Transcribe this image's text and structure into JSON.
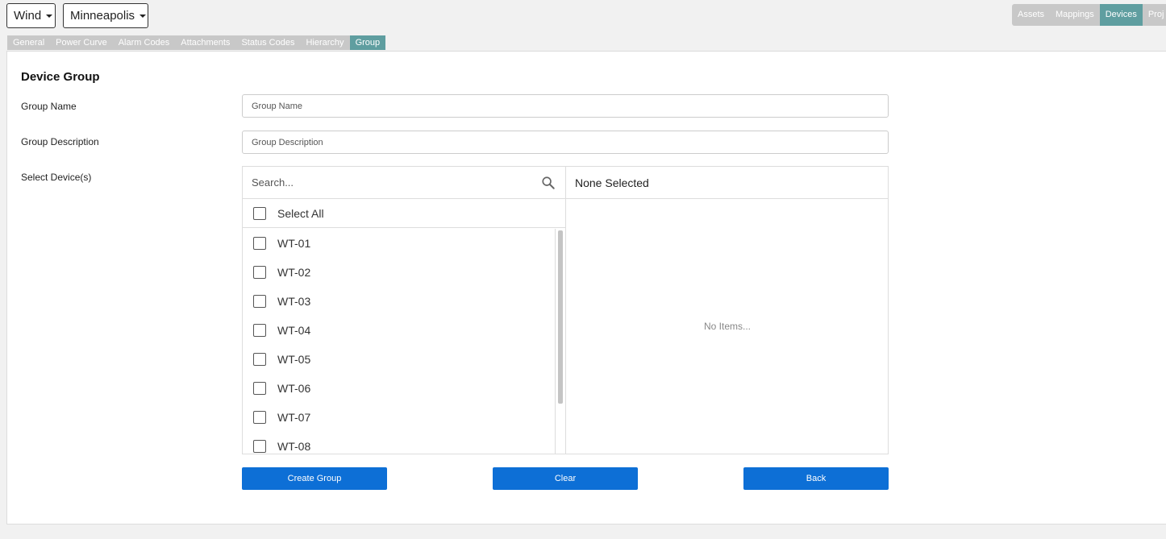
{
  "header": {
    "type_dropdown": "Wind",
    "site_dropdown": "Minneapolis",
    "top_tabs": [
      {
        "label": "Assets"
      },
      {
        "label": "Mappings"
      },
      {
        "label": "Devices"
      },
      {
        "label": "Proj"
      }
    ],
    "top_tabs_active": "Devices"
  },
  "sub_tabs": [
    {
      "label": "General"
    },
    {
      "label": "Power Curve"
    },
    {
      "label": "Alarm Codes"
    },
    {
      "label": "Attachments"
    },
    {
      "label": "Status Codes"
    },
    {
      "label": "Hierarchy"
    },
    {
      "label": "Group"
    }
  ],
  "sub_tabs_active": "Group",
  "form": {
    "title": "Device Group",
    "group_name_label": "Group Name",
    "group_name_placeholder": "Group Name",
    "group_description_label": "Group Description",
    "group_description_placeholder": "Group Description",
    "select_devices_label": "Select Device(s)"
  },
  "device_picker": {
    "search_placeholder": "Search...",
    "select_all_label": "Select All",
    "devices": [
      "WT-01",
      "WT-02",
      "WT-03",
      "WT-04",
      "WT-05",
      "WT-06",
      "WT-07",
      "WT-08"
    ],
    "selected_header": "None Selected",
    "empty_text": "No Items..."
  },
  "buttons": {
    "create": "Create Group",
    "clear": "Clear",
    "back": "Back"
  },
  "colors": {
    "active_tab": "#5f9ea0",
    "inactive_tab": "#c8c8c8",
    "primary_button": "#0d6fd6"
  }
}
